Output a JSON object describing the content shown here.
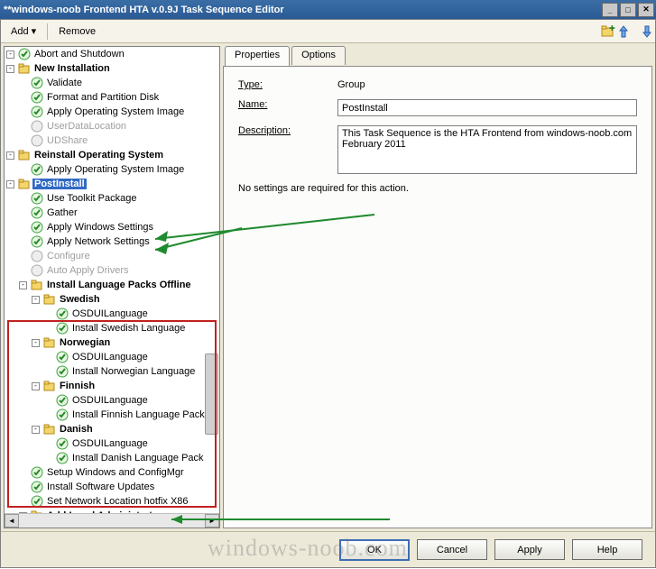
{
  "window": {
    "title": "**windows-noob Frontend HTA v.0.9J Task Sequence Editor"
  },
  "toolbar": {
    "add": "Add",
    "remove": "Remove"
  },
  "tree": {
    "abort": "Abort and Shutdown",
    "newinst": "New Installation",
    "validate": "Validate",
    "format": "Format and Partition Disk",
    "applyos1": "Apply Operating System Image",
    "userdata": "UserDataLocation",
    "udshare": "UDShare",
    "reinst": "Reinstall Operating System",
    "applyos2": "Apply Operating System Image",
    "postinstall": "PostInstall",
    "usetoolkit": "Use Toolkit Package",
    "gather": "Gather",
    "applywin": "Apply Windows Settings",
    "applynet": "Apply Network Settings",
    "configure": "Configure",
    "autodriv": "Auto Apply Drivers",
    "langpacks": "Install Language Packs Offline",
    "swedish": "Swedish",
    "osdui": "OSDUILanguage",
    "instsw": "Install Swedish Language",
    "norwegian": "Norwegian",
    "instno": "Install Norwegian Language",
    "finnish": "Finnish",
    "instfi": "Install Finnish Language Pack",
    "danish": "Danish",
    "instda": "Install Danish Language Pack",
    "setupwin": "Setup Windows and ConfigMgr",
    "instsoft": "Install Software Updates",
    "setnet": "Set Network Location hotfix X86",
    "addlocal": "Add Local Administrator"
  },
  "tabs": {
    "properties": "Properties",
    "options": "Options"
  },
  "form": {
    "type_label": "Type:",
    "type_value": "Group",
    "name_label": "Name:",
    "name_value": "PostInstall",
    "desc_label": "Description:",
    "desc_value": "This Task Sequence is the HTA Frontend from windows-noob.com February 2011",
    "info": "No settings are required for this action."
  },
  "buttons": {
    "ok": "OK",
    "cancel": "Cancel",
    "apply": "Apply",
    "help": "Help"
  },
  "watermark": "windows-noob.com"
}
